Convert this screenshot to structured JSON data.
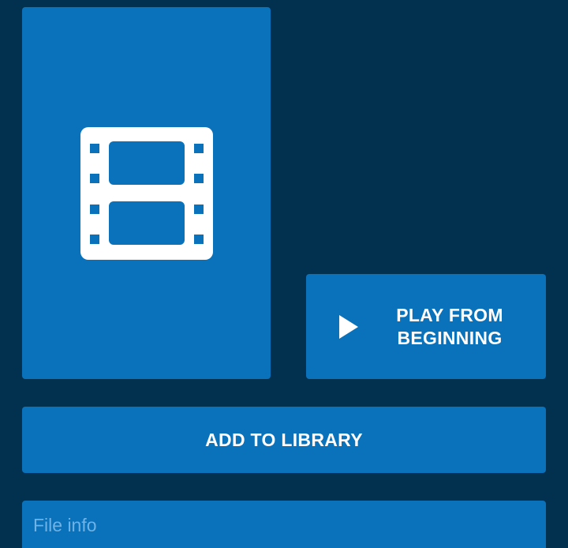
{
  "poster": {
    "icon": "film-strip-icon",
    "background_color": "#0a71bb"
  },
  "actions": {
    "play_icon": "play-icon",
    "play_label": "PLAY FROM BEGINNING",
    "add_to_library_label": "ADD TO LIBRARY"
  },
  "file_info": {
    "title": "File info"
  },
  "colors": {
    "page_background": "#01314f",
    "accent": "#0a71bb",
    "muted_text": "#6fb3e6"
  }
}
